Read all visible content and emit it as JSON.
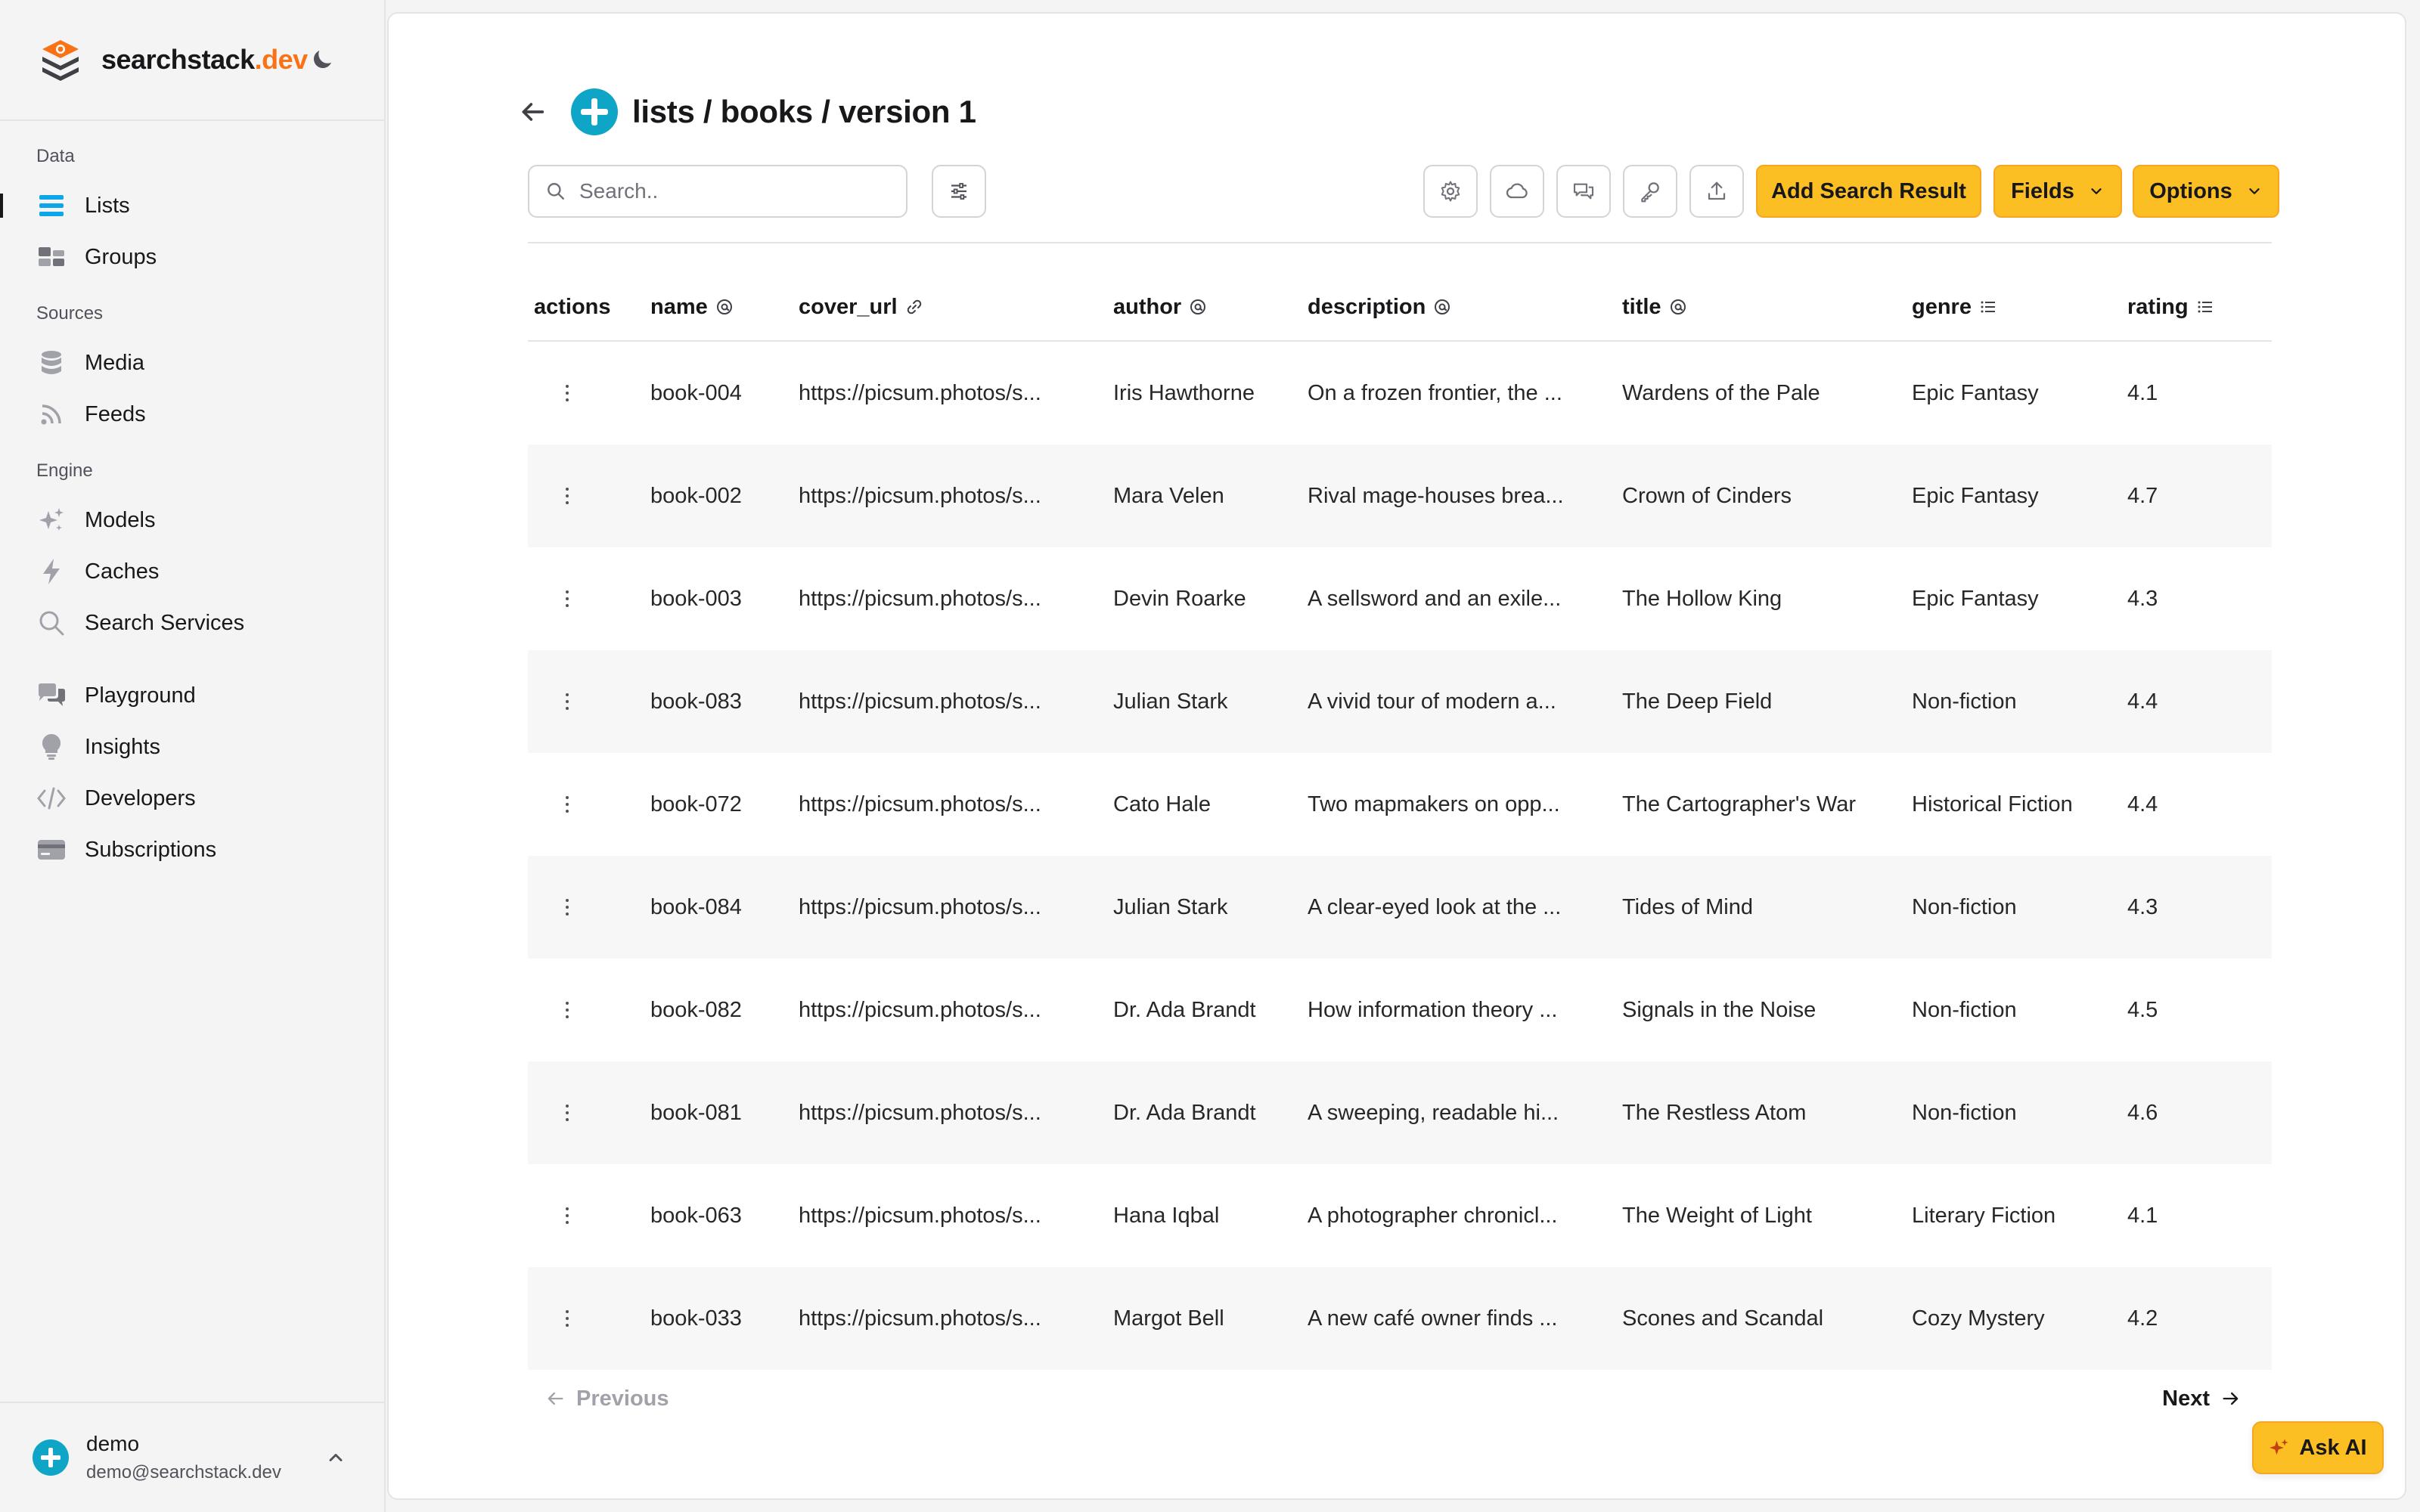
{
  "brand": {
    "name": "searchstack",
    "suffix": ".dev"
  },
  "sidebar": {
    "sections": [
      {
        "label": "Data",
        "items": [
          {
            "label": "Lists",
            "icon": "list-icon",
            "active": true
          },
          {
            "label": "Groups",
            "icon": "groups-icon"
          }
        ]
      },
      {
        "label": "Sources",
        "items": [
          {
            "label": "Media",
            "icon": "database-icon"
          },
          {
            "label": "Feeds",
            "icon": "rss-icon"
          }
        ]
      },
      {
        "label": "Engine",
        "items": [
          {
            "label": "Models",
            "icon": "sparkles-icon"
          },
          {
            "label": "Caches",
            "icon": "bolt-icon"
          },
          {
            "label": "Search Services",
            "icon": "search-icon"
          }
        ]
      },
      {
        "label": "",
        "items": [
          {
            "label": "Playground",
            "icon": "chat-icon"
          },
          {
            "label": "Insights",
            "icon": "lightbulb-icon"
          },
          {
            "label": "Developers",
            "icon": "code-icon"
          },
          {
            "label": "Subscriptions",
            "icon": "credit-card-icon"
          }
        ]
      }
    ]
  },
  "user": {
    "name": "demo",
    "email": "demo@searchstack.dev"
  },
  "header": {
    "title": "lists / books / version 1"
  },
  "search": {
    "placeholder": "Search.."
  },
  "toolbar": {
    "add_label": "Add Search Result",
    "fields_label": "Fields",
    "options_label": "Options"
  },
  "table": {
    "columns": [
      "actions",
      "name",
      "cover_url",
      "author",
      "description",
      "title",
      "genre",
      "rating"
    ],
    "rows": [
      [
        "book-004",
        "https://picsum.photos/s...",
        "Iris Hawthorne",
        "On a frozen frontier, the ...",
        "Wardens of the Pale",
        "Epic Fantasy",
        "4.1"
      ],
      [
        "book-002",
        "https://picsum.photos/s...",
        "Mara Velen",
        "Rival mage-houses brea...",
        "Crown of Cinders",
        "Epic Fantasy",
        "4.7"
      ],
      [
        "book-003",
        "https://picsum.photos/s...",
        "Devin Roarke",
        "A sellsword and an exile...",
        "The Hollow King",
        "Epic Fantasy",
        "4.3"
      ],
      [
        "book-083",
        "https://picsum.photos/s...",
        "Julian Stark",
        "A vivid tour of modern a...",
        "The Deep Field",
        "Non-fiction",
        "4.4"
      ],
      [
        "book-072",
        "https://picsum.photos/s...",
        "Cato Hale",
        "Two mapmakers on opp...",
        "The Cartographer's War",
        "Historical Fiction",
        "4.4"
      ],
      [
        "book-084",
        "https://picsum.photos/s...",
        "Julian Stark",
        "A clear-eyed look at the ...",
        "Tides of Mind",
        "Non-fiction",
        "4.3"
      ],
      [
        "book-082",
        "https://picsum.photos/s...",
        "Dr. Ada Brandt",
        "How information theory ...",
        "Signals in the Noise",
        "Non-fiction",
        "4.5"
      ],
      [
        "book-081",
        "https://picsum.photos/s...",
        "Dr. Ada Brandt",
        "A sweeping, readable hi...",
        "The Restless Atom",
        "Non-fiction",
        "4.6"
      ],
      [
        "book-063",
        "https://picsum.photos/s...",
        "Hana Iqbal",
        "A photographer chronicl...",
        "The Weight of Light",
        "Literary Fiction",
        "4.1"
      ],
      [
        "book-033",
        "https://picsum.photos/s...",
        "Margot Bell",
        "A new café owner finds ...",
        "Scones and Scandal",
        "Cozy Mystery",
        "4.2"
      ]
    ]
  },
  "pagination": {
    "previous": "Previous",
    "next": "Next"
  },
  "ask_ai": {
    "label": "Ask AI"
  },
  "colors": {
    "accent": "#fbbf24",
    "brand_orange": "#f97316",
    "teal": "#0ea5c6"
  }
}
